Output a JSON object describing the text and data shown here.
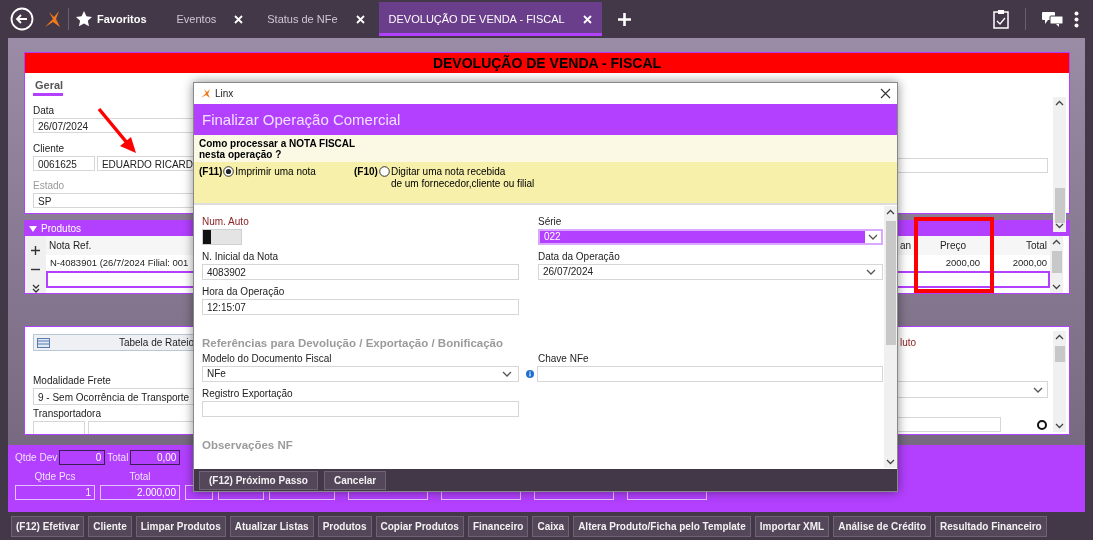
{
  "top_bar": {
    "favorites": "Favoritos",
    "tabs": [
      {
        "label": "Eventos",
        "selected": false
      },
      {
        "label": "Status de NFe",
        "selected": false
      },
      {
        "label": "DEVOLUÇÃO DE VENDA - FISCAL",
        "selected": true
      }
    ]
  },
  "screen_title": "DEVOLUÇÃO DE VENDA - FISCAL",
  "general": {
    "tab": "Geral",
    "fields": [
      {
        "label": "Data",
        "values": [
          "26/07/2024"
        ],
        "disabled": false
      },
      {
        "label": "Cliente",
        "values": [
          "0061625",
          "EDUARDO RICARD"
        ],
        "disabled": false
      },
      {
        "label": "Estado",
        "values": [
          "SP"
        ],
        "disabled": true
      }
    ]
  },
  "products": {
    "title": "Produtos",
    "columns": [
      "Nota Ref.",
      "an",
      "Preço",
      "Total"
    ],
    "rows": [
      {
        "nota_ref": "N-4083901 (26/7/2024 Filial: 001",
        "preco": "2000,00",
        "total": "2000,00"
      }
    ]
  },
  "shipping": {
    "rateio_button": "Tabela de Rateio",
    "freight_label": "Modalidade Frete",
    "freight_value": "9 - Sem Ocorrência de Transporte",
    "carrier_label": "Transportadora",
    "column_2_text": "luto"
  },
  "totals": {
    "qtde_dev_label": "Qtde Dev",
    "qtde_dev": "0",
    "total_label": "Total",
    "total": "0,00",
    "columns": [
      {
        "label": "Qtde Pcs",
        "value": "1"
      },
      {
        "label": "Total",
        "value": "2.000,00"
      }
    ]
  },
  "actions": [
    "(F12) Efetivar",
    "Cliente",
    "Limpar Produtos",
    "Atualizar Listas",
    "Produtos",
    "Copiar Produtos",
    "Financeiro",
    "Caixa",
    "Altera Produto/Ficha pelo Template",
    "Importar XML",
    "Análise de Crédito",
    "Resultado Financeiro"
  ],
  "dialog": {
    "title": "Linx",
    "heading": "Finalizar Operação Comercial",
    "question": "Como processar a NOTA FISCAL\nnesta operação ?",
    "options": [
      {
        "key": "(F11)",
        "label": "Imprimir uma nota",
        "selected": true
      },
      {
        "key": "(F10)",
        "label": "Digitar uma nota recebida\nde um fornecedor,cliente ou filial",
        "selected": false
      }
    ],
    "top": {
      "left": [
        {
          "kind": "toggle",
          "label": "Num. Auto",
          "on": false
        },
        {
          "kind": "text",
          "label": "N. Inicial da Nota",
          "value": "4083902"
        },
        {
          "kind": "text",
          "label": "Hora da Operação",
          "value": "12:15:07"
        }
      ],
      "right": [
        {
          "kind": "select",
          "label": "Série",
          "value": "022",
          "focused": true
        },
        {
          "kind": "select",
          "label": "Data da Operação",
          "value": "26/07/2024",
          "focused": false
        }
      ]
    },
    "references": {
      "title": "Referências para Devolução / Exportação / Bonificação",
      "left": [
        {
          "kind": "select",
          "label": "Modelo do Documento Fiscal",
          "value": "NFe",
          "focused": false
        },
        {
          "kind": "text",
          "label": "Registro Exportação"
        }
      ],
      "right": [
        {
          "kind": "text",
          "label": "Chave NFe",
          "info": true
        }
      ]
    },
    "observations": {
      "title": "Observações NF"
    },
    "buttons": [
      "(F12) Próximo Passo",
      "Cancelar"
    ]
  },
  "annotations": {
    "arrow": true,
    "frame": true
  }
}
